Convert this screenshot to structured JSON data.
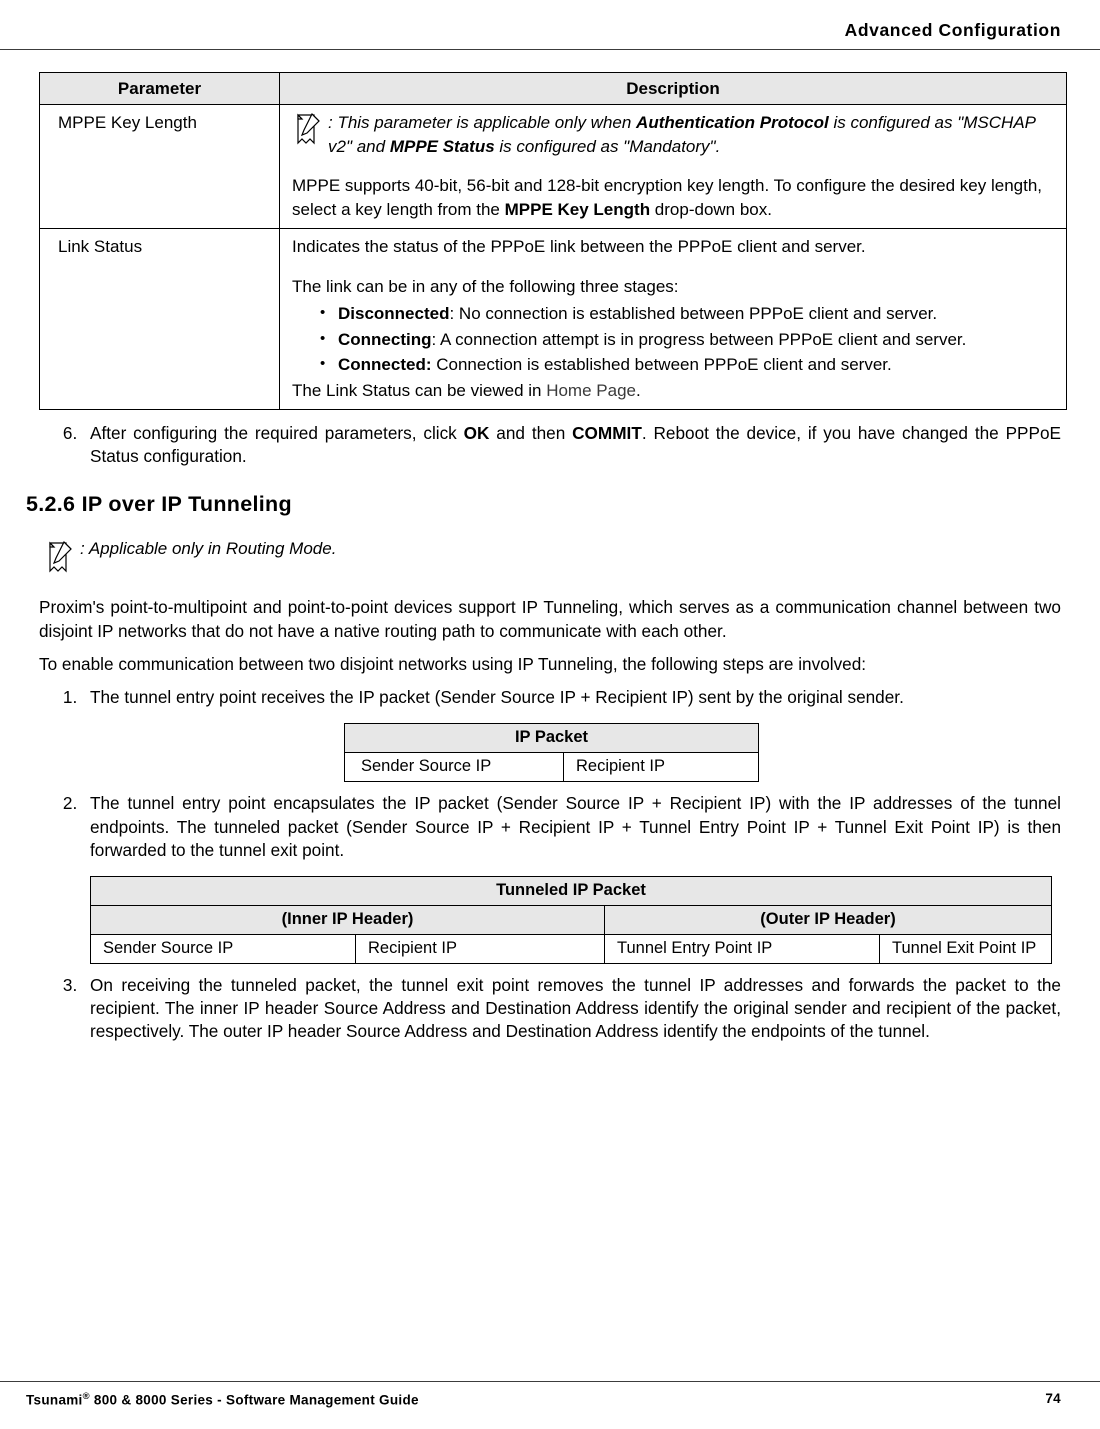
{
  "header": {
    "title": "Advanced Configuration"
  },
  "paramTable": {
    "head": {
      "param": "Parameter",
      "desc": "Description"
    },
    "rows": {
      "mppe": {
        "param": "MPPE Key Length",
        "note_prefix": ": This parameter is applicable only when ",
        "note_b1": "Authentication Protocol",
        "note_mid": " is configured as \"MSCHAP v2\" and ",
        "note_b2": "MPPE Status",
        "note_suffix": " is configured as \"Mandatory\".",
        "body_a": "MPPE supports 40-bit, 56-bit and 128-bit encryption key length. To configure the desired key length, select a key length from the ",
        "body_b": "MPPE Key Length",
        "body_c": " drop-down box."
      },
      "link": {
        "param": "Link Status",
        "intro": "Indicates the status of the PPPoE link between the PPPoE client and server.",
        "stages_intro": "The link can be in any of the following three stages:",
        "b_disc_l": "Disconnected",
        "b_disc_t": ": No connection is established between PPPoE client and server.",
        "b_conn_l": "Connecting",
        "b_conn_t": ": A connection attempt is in progress between PPPoE client and server.",
        "b_cond_l": "Connected:",
        "b_cond_t": " Connection is established between PPPoE client and server.",
        "outro_a": "The Link Status can be viewed in ",
        "outro_link": "Home Page",
        "outro_b": "."
      }
    }
  },
  "step6": {
    "a": "After configuring the required parameters, click ",
    "b1": "OK",
    "b": " and then ",
    "b2": "COMMIT",
    "c": ". Reboot the device, if you have changed the PPPoE Status configuration."
  },
  "section": {
    "heading": "5.2.6 IP over IP Tunneling"
  },
  "modeNote": {
    "text": ": Applicable only in Routing Mode."
  },
  "intro1": "Proxim's point-to-multipoint and point-to-point devices support IP Tunneling, which serves as a communication channel between two disjoint IP networks that do not have a native routing path to communicate with each other.",
  "intro2": "To enable communication between two disjoint networks using IP Tunneling, the following steps are involved:",
  "tunSteps": {
    "s1": "The tunnel entry point receives the IP packet (Sender Source IP + Recipient IP) sent by the original sender.",
    "s2": "The tunnel entry point encapsulates the IP packet (Sender Source IP + Recipient IP) with the IP addresses of the tunnel endpoints. The tunneled packet (Sender Source IP + Recipient IP + Tunnel Entry Point IP + Tunnel Exit Point IP) is then forwarded to the tunnel exit point.",
    "s3": "On receiving the tunneled packet, the tunnel exit point removes the tunnel IP addresses and forwards the packet to the recipient. The inner IP header Source Address and Destination Address identify the original sender and recipient of the packet, respectively. The outer IP header Source Address and Destination Address identify the endpoints of the tunnel."
  },
  "ipTable": {
    "head": "IP Packet",
    "c1": "Sender Source IP",
    "c2": "Recipient IP"
  },
  "tunnelTable": {
    "head": "Tunneled IP Packet",
    "inner": "(Inner IP Header)",
    "outer": "(Outer IP Header)",
    "c1": "Sender Source IP",
    "c2": "Recipient IP",
    "c3": "Tunnel Entry Point IP",
    "c4": "Tunnel Exit Point IP"
  },
  "footer": {
    "left_a": "Tsunami",
    "left_sup": "®",
    "left_b": " 800 & 8000 Series - Software Management Guide",
    "page": "74"
  }
}
